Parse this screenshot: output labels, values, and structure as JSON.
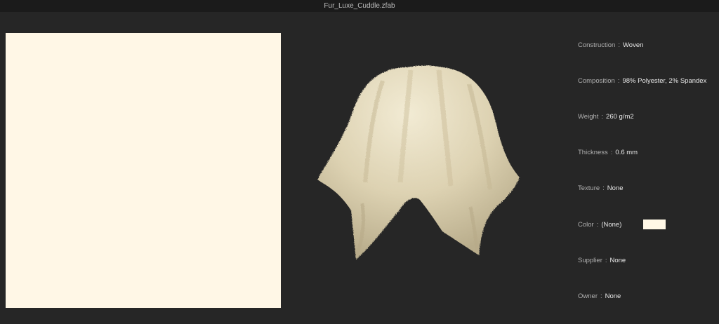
{
  "window": {
    "title": "Fur_Luxe_Cuddle.zfab"
  },
  "swatch": {
    "color": "#fff7e6"
  },
  "drape": {
    "fabric_color": "#e9e0c4",
    "background": "#262626"
  },
  "properties": [
    {
      "label": "Construction",
      "value": "Woven"
    },
    {
      "label": "Composition",
      "value": "98% Polyester, 2% Spandex"
    },
    {
      "label": "Weight",
      "value": "260 g/m2"
    },
    {
      "label": "Thickness",
      "value": "0.6 mm"
    },
    {
      "label": "Texture",
      "value": "None"
    },
    {
      "label": "Color",
      "value": "(None)"
    },
    {
      "label": "Supplier",
      "value": "None"
    },
    {
      "label": "Owner",
      "value": "None"
    }
  ],
  "separator": ":",
  "color_chip": {
    "color": "#fff7e6"
  }
}
